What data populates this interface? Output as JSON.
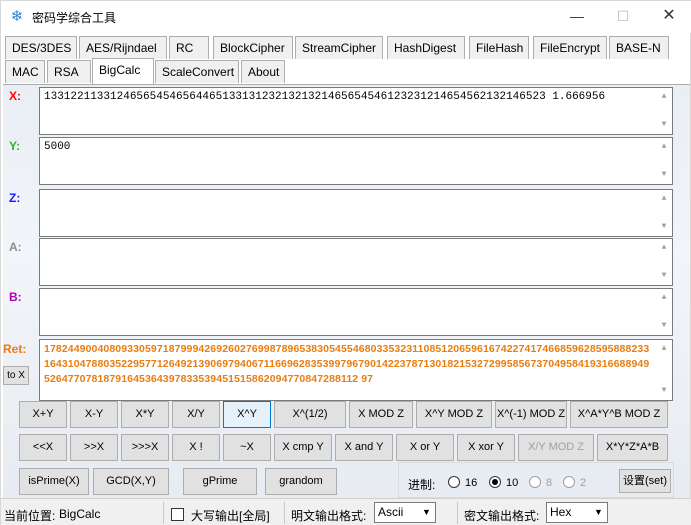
{
  "window": {
    "title": "密码学综合工具",
    "icon": "snowflake-icon",
    "controls": {
      "minimize": "—",
      "maximize": "☐",
      "close": "✕"
    }
  },
  "tabs_row1": [
    "DES/3DES",
    "AES/Rijndael",
    "RC",
    "BlockCipher",
    "StreamCipher",
    "HashDigest",
    "FileHash",
    "FileEncrypt",
    "BASE-N"
  ],
  "tabs_row2": [
    "MAC",
    "RSA",
    "BigCalc",
    "ScaleConvert",
    "About"
  ],
  "active_tab": "BigCalc",
  "fields": {
    "x": {
      "label": "X:",
      "value": "1331221133124656545465644651331312321321321465654546123231214654562132146523 1.666956",
      "color": "#ff0000"
    },
    "y": {
      "label": "Y:",
      "value": "5000",
      "color": "#2fb02f"
    },
    "z": {
      "label": "Z:",
      "value": "",
      "color": "#1a1aff"
    },
    "a": {
      "label": "A:",
      "value": "",
      "color": "#8c8c8c"
    },
    "b": {
      "label": "B:",
      "value": "",
      "color": "#b000b0"
    },
    "ret": {
      "label": "Ret:",
      "value": "17824490040809330597187999426926027699878965383054554680335323110851206596167422741746685962859588823316431047880352295771264921390697940671166962835399796790142237871301821532729958567370495841931668894952647707818791645364397833539451515862094770847288112 97",
      "color": "#e87d12"
    },
    "to_x_button": "to X"
  },
  "buttons_row1": [
    "X+Y",
    "X-Y",
    "X*Y",
    "X/Y",
    "X^Y",
    "X^(1/2)",
    "X MOD Z",
    "X^Y MOD Z",
    "X^(-1) MOD Z",
    "X^A*Y^B MOD Z"
  ],
  "buttons_row2": [
    "<<X",
    ">>X",
    ">>>X",
    "X !",
    "~X",
    "X cmp Y",
    "X and Y",
    "X or Y",
    "X xor Y",
    "X/Y MOD Z",
    "X*Y*Z*A*B"
  ],
  "buttons_row3": [
    "isPrime(X)",
    "GCD(X,Y)",
    "gPrime",
    "grandom"
  ],
  "radix": {
    "label": "进制:",
    "options": [
      "16",
      "10",
      "8",
      "2"
    ],
    "selected": "10",
    "settings_button": "设置(set)"
  },
  "statusbar": {
    "location_label": "当前位置:",
    "location_value": "BigCalc",
    "uppercase_checkbox_label": "大写输出[全局]",
    "plain_format_label": "明文输出格式:",
    "plain_format_value": "Ascii",
    "cipher_format_label": "密文输出格式:",
    "cipher_format_value": "Hex"
  }
}
